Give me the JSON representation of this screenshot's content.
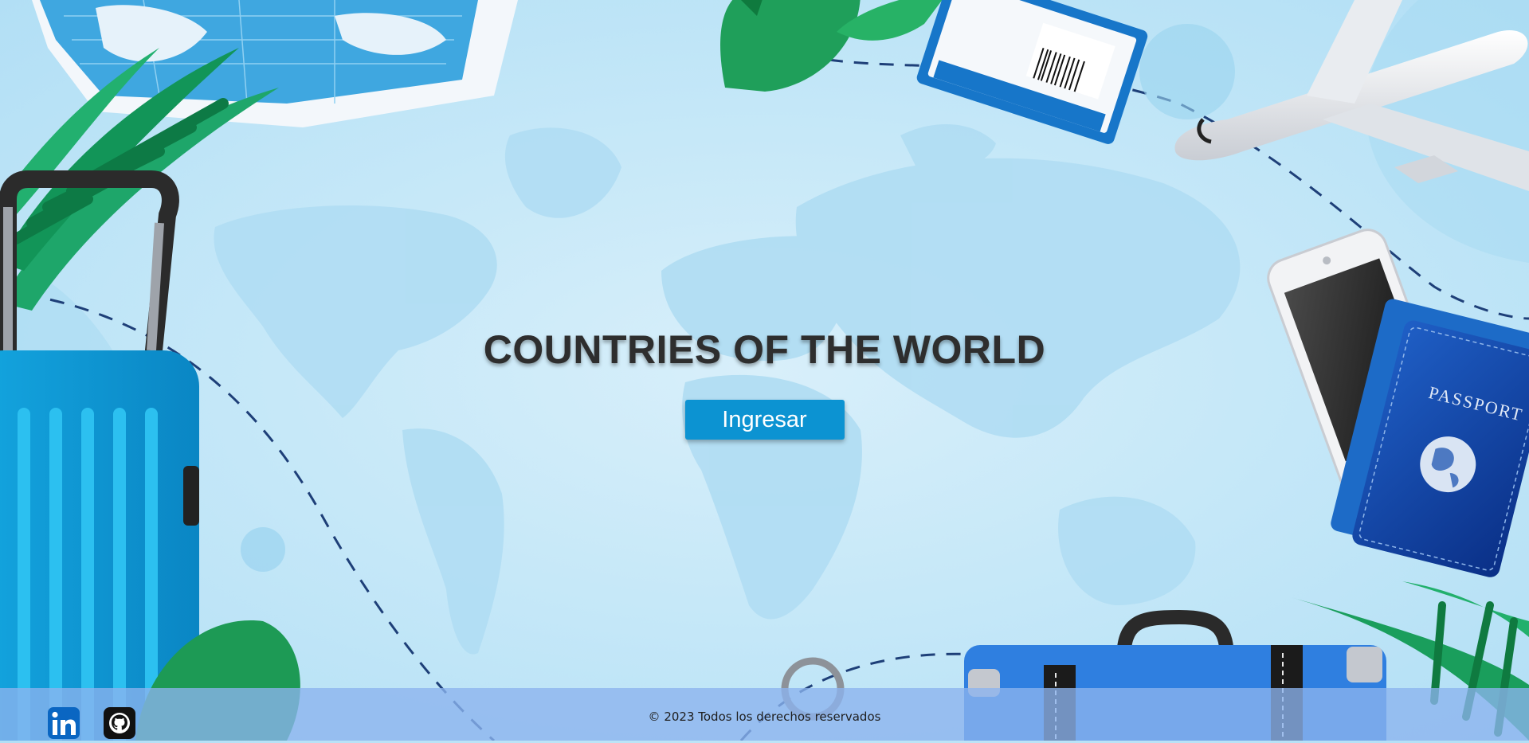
{
  "hero": {
    "title": "COUNTRIES OF THE WORLD",
    "enter_label": "Ingresar"
  },
  "footer": {
    "copyright": "© 2023 Todos los derechos reservados",
    "social": [
      {
        "icon": "linkedin-icon",
        "label": "in"
      },
      {
        "icon": "github-icon"
      }
    ]
  },
  "colors": {
    "background": "#c6e8f8",
    "title": "#2e2e2e",
    "button": "#0c93d2",
    "footer": "#8cb4ee",
    "linkedin": "#0a66c2",
    "github": "#111111"
  }
}
